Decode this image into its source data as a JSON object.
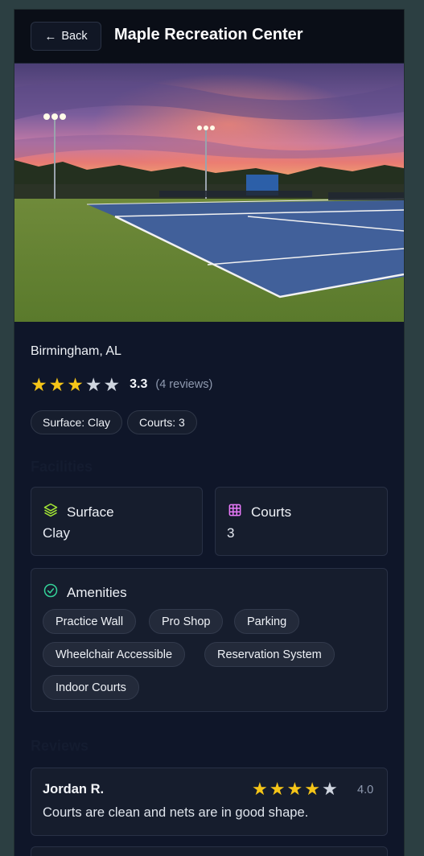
{
  "header": {
    "back_label": "Back",
    "back_arrow": "←",
    "title": "Maple Recreation Center"
  },
  "hero": {
    "scene": "tennis-courts-at-dusk"
  },
  "location": "Birmingham, AL",
  "rating": {
    "value": "3.3",
    "count_text": "(4 reviews)",
    "stars": 3,
    "max": 5
  },
  "tags": [
    "Surface: Clay",
    "Courts: 3"
  ],
  "sections": {
    "facilities_heading": "Facilities",
    "reviews_heading": "Reviews"
  },
  "facilities": {
    "surface": {
      "icon": "layers-icon",
      "label": "Surface",
      "value": "Clay"
    },
    "courts": {
      "icon": "grid-icon",
      "label": "Courts",
      "value": "3"
    }
  },
  "amenities": {
    "icon": "check-circle-icon",
    "label": "Amenities",
    "items": [
      "Practice Wall",
      "Pro Shop",
      "Parking",
      "Wheelchair Accessible",
      "Reservation System",
      "Indoor Courts"
    ]
  },
  "reviews": [
    {
      "author": "Jordan R.",
      "stars": 4,
      "score": "4.0",
      "text": "Courts are clean and nets are in good shape."
    }
  ],
  "colors": {
    "star_on": "#f5c518",
    "star_off": "#cfd5df",
    "surface_icon": "#a3e635",
    "courts_icon": "#e879f9",
    "amenities_icon": "#34d399"
  }
}
